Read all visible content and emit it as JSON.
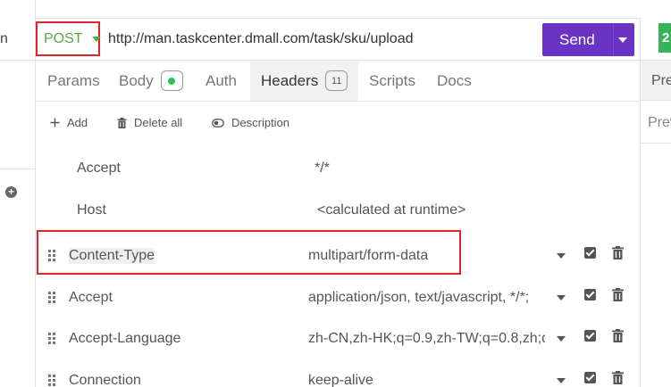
{
  "left": {
    "cut_text": "n"
  },
  "request": {
    "method": "POST",
    "url": "http://man.taskcenter.dmall.com/task/sku/upload",
    "send_label": "Send"
  },
  "tabs": [
    {
      "label": "Params"
    },
    {
      "label": "Body"
    },
    {
      "label": "Auth"
    },
    {
      "label": "Headers",
      "count": "11"
    },
    {
      "label": "Scripts"
    },
    {
      "label": "Docs"
    }
  ],
  "toolbar": {
    "add_label": "Add",
    "delete_all_label": "Delete all",
    "description_label": "Description"
  },
  "headers": [
    {
      "name": "Accept",
      "value": "*/*",
      "readonly": true
    },
    {
      "name": "Host",
      "value": "<calculated at runtime>",
      "readonly": true
    },
    {
      "name": "Content-Type",
      "value": "multipart/form-data",
      "enabled": true
    },
    {
      "name": "Accept",
      "value": "application/json, text/javascript, */*;",
      "enabled": true
    },
    {
      "name": "Accept-Language",
      "value": "zh-CN,zh-HK;q=0.9,zh-TW;q=0.8,zh;q",
      "enabled": true
    },
    {
      "name": "Connection",
      "value": "keep-alive",
      "enabled": true
    }
  ],
  "right_panel": {
    "badge_text": "2",
    "tab_label": "Pre",
    "sub_label": "Prev"
  },
  "colors": {
    "method": "#58a84a",
    "send": "#6b33c4",
    "highlight": "#e0242b",
    "body_dot": "#2ec05a"
  }
}
